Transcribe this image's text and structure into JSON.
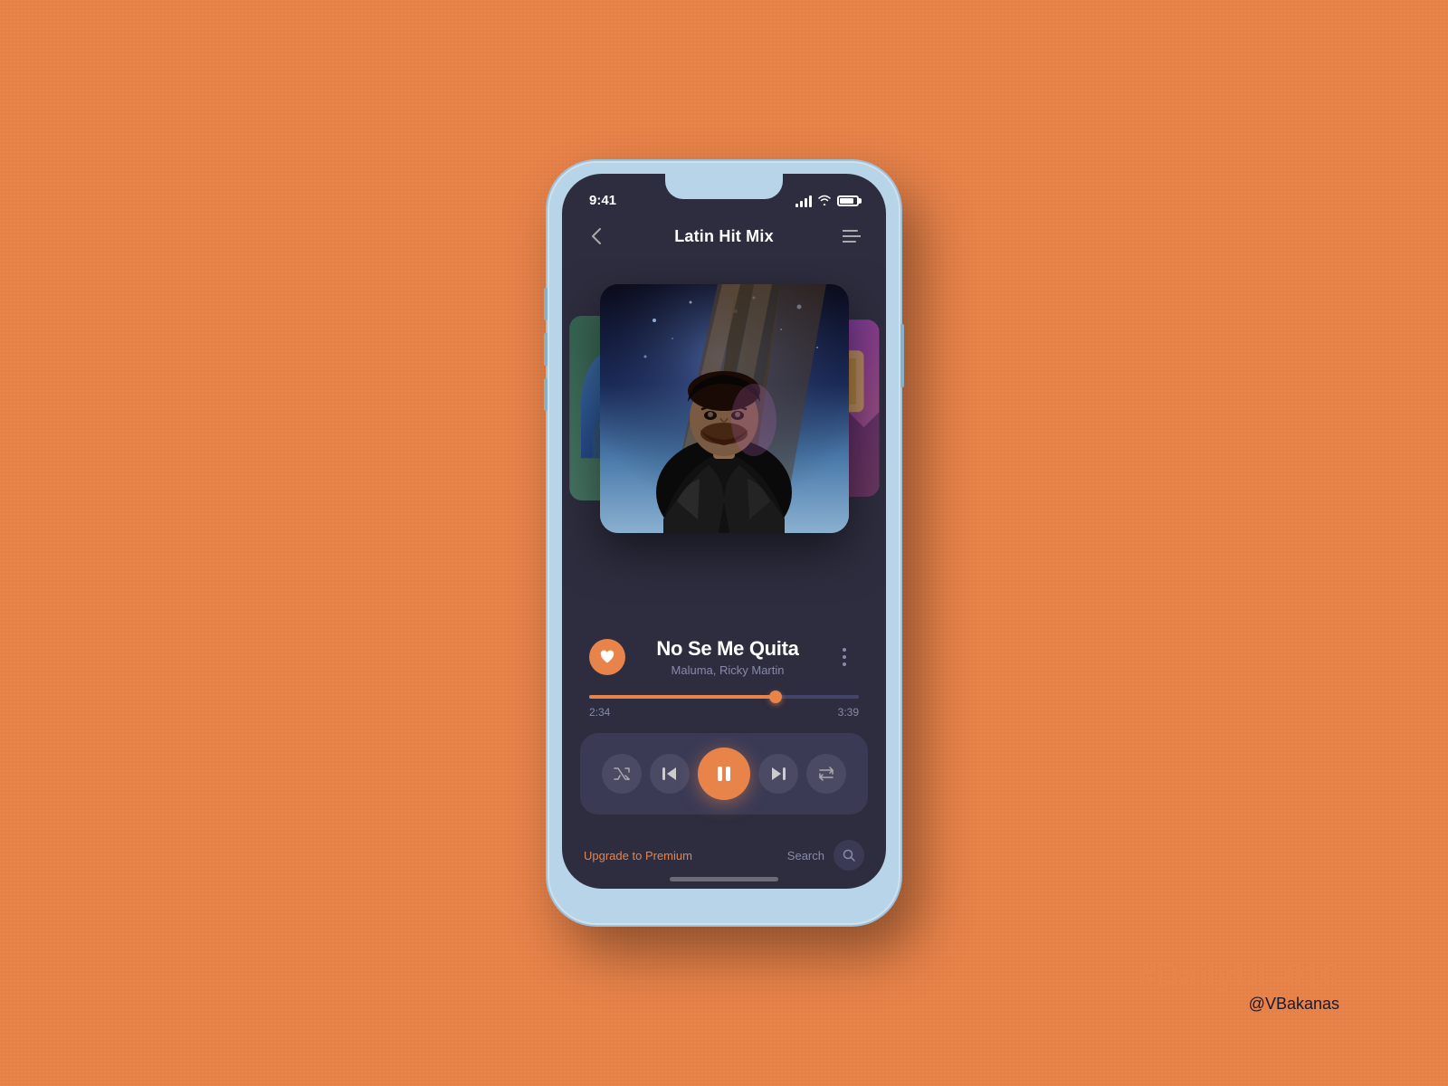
{
  "background": {
    "color": "#E8834A"
  },
  "watermark": {
    "dailyui": "#DailyUI",
    "number": "–010",
    "handle": "@VBakanas"
  },
  "phone": {
    "status_bar": {
      "time": "9:41",
      "signal": "full",
      "wifi": "on",
      "battery": "full"
    },
    "header": {
      "title": "Latin Hit Mix",
      "back_label": "‹",
      "menu_label": "≡"
    },
    "carousel": {
      "left_card": "prev album",
      "main_card": "No Se Me Quita - Maluma",
      "right_card": "next album"
    },
    "song": {
      "title": "No Se Me Quita",
      "artist": "Maluma, Ricky Martin",
      "liked": true
    },
    "progress": {
      "current_time": "2:34",
      "total_time": "3:39",
      "percent": 69
    },
    "controls": {
      "shuffle_label": "shuffle",
      "prev_label": "previous",
      "play_label": "pause",
      "next_label": "next",
      "repeat_label": "repeat"
    },
    "bottom_bar": {
      "upgrade_text": "Upgrade to",
      "upgrade_link": "Premium",
      "search_label": "Search"
    }
  }
}
